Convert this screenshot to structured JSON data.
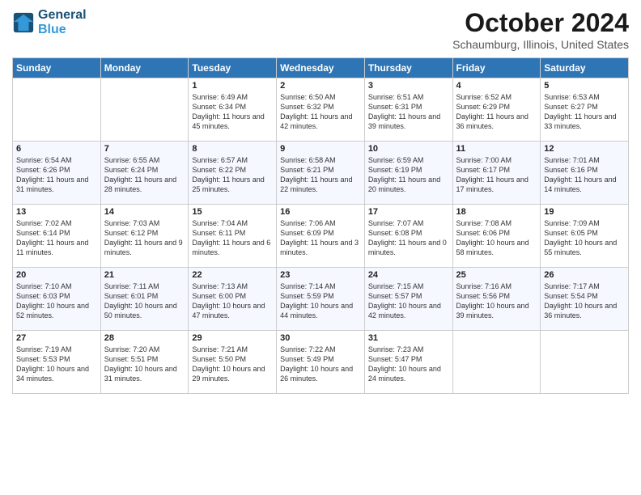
{
  "header": {
    "logo_line1": "General",
    "logo_line2": "Blue",
    "month": "October 2024",
    "location": "Schaumburg, Illinois, United States"
  },
  "weekdays": [
    "Sunday",
    "Monday",
    "Tuesday",
    "Wednesday",
    "Thursday",
    "Friday",
    "Saturday"
  ],
  "weeks": [
    [
      {
        "day": "",
        "info": ""
      },
      {
        "day": "",
        "info": ""
      },
      {
        "day": "1",
        "info": "Sunrise: 6:49 AM\nSunset: 6:34 PM\nDaylight: 11 hours and 45 minutes."
      },
      {
        "day": "2",
        "info": "Sunrise: 6:50 AM\nSunset: 6:32 PM\nDaylight: 11 hours and 42 minutes."
      },
      {
        "day": "3",
        "info": "Sunrise: 6:51 AM\nSunset: 6:31 PM\nDaylight: 11 hours and 39 minutes."
      },
      {
        "day": "4",
        "info": "Sunrise: 6:52 AM\nSunset: 6:29 PM\nDaylight: 11 hours and 36 minutes."
      },
      {
        "day": "5",
        "info": "Sunrise: 6:53 AM\nSunset: 6:27 PM\nDaylight: 11 hours and 33 minutes."
      }
    ],
    [
      {
        "day": "6",
        "info": "Sunrise: 6:54 AM\nSunset: 6:26 PM\nDaylight: 11 hours and 31 minutes."
      },
      {
        "day": "7",
        "info": "Sunrise: 6:55 AM\nSunset: 6:24 PM\nDaylight: 11 hours and 28 minutes."
      },
      {
        "day": "8",
        "info": "Sunrise: 6:57 AM\nSunset: 6:22 PM\nDaylight: 11 hours and 25 minutes."
      },
      {
        "day": "9",
        "info": "Sunrise: 6:58 AM\nSunset: 6:21 PM\nDaylight: 11 hours and 22 minutes."
      },
      {
        "day": "10",
        "info": "Sunrise: 6:59 AM\nSunset: 6:19 PM\nDaylight: 11 hours and 20 minutes."
      },
      {
        "day": "11",
        "info": "Sunrise: 7:00 AM\nSunset: 6:17 PM\nDaylight: 11 hours and 17 minutes."
      },
      {
        "day": "12",
        "info": "Sunrise: 7:01 AM\nSunset: 6:16 PM\nDaylight: 11 hours and 14 minutes."
      }
    ],
    [
      {
        "day": "13",
        "info": "Sunrise: 7:02 AM\nSunset: 6:14 PM\nDaylight: 11 hours and 11 minutes."
      },
      {
        "day": "14",
        "info": "Sunrise: 7:03 AM\nSunset: 6:12 PM\nDaylight: 11 hours and 9 minutes."
      },
      {
        "day": "15",
        "info": "Sunrise: 7:04 AM\nSunset: 6:11 PM\nDaylight: 11 hours and 6 minutes."
      },
      {
        "day": "16",
        "info": "Sunrise: 7:06 AM\nSunset: 6:09 PM\nDaylight: 11 hours and 3 minutes."
      },
      {
        "day": "17",
        "info": "Sunrise: 7:07 AM\nSunset: 6:08 PM\nDaylight: 11 hours and 0 minutes."
      },
      {
        "day": "18",
        "info": "Sunrise: 7:08 AM\nSunset: 6:06 PM\nDaylight: 10 hours and 58 minutes."
      },
      {
        "day": "19",
        "info": "Sunrise: 7:09 AM\nSunset: 6:05 PM\nDaylight: 10 hours and 55 minutes."
      }
    ],
    [
      {
        "day": "20",
        "info": "Sunrise: 7:10 AM\nSunset: 6:03 PM\nDaylight: 10 hours and 52 minutes."
      },
      {
        "day": "21",
        "info": "Sunrise: 7:11 AM\nSunset: 6:01 PM\nDaylight: 10 hours and 50 minutes."
      },
      {
        "day": "22",
        "info": "Sunrise: 7:13 AM\nSunset: 6:00 PM\nDaylight: 10 hours and 47 minutes."
      },
      {
        "day": "23",
        "info": "Sunrise: 7:14 AM\nSunset: 5:59 PM\nDaylight: 10 hours and 44 minutes."
      },
      {
        "day": "24",
        "info": "Sunrise: 7:15 AM\nSunset: 5:57 PM\nDaylight: 10 hours and 42 minutes."
      },
      {
        "day": "25",
        "info": "Sunrise: 7:16 AM\nSunset: 5:56 PM\nDaylight: 10 hours and 39 minutes."
      },
      {
        "day": "26",
        "info": "Sunrise: 7:17 AM\nSunset: 5:54 PM\nDaylight: 10 hours and 36 minutes."
      }
    ],
    [
      {
        "day": "27",
        "info": "Sunrise: 7:19 AM\nSunset: 5:53 PM\nDaylight: 10 hours and 34 minutes."
      },
      {
        "day": "28",
        "info": "Sunrise: 7:20 AM\nSunset: 5:51 PM\nDaylight: 10 hours and 31 minutes."
      },
      {
        "day": "29",
        "info": "Sunrise: 7:21 AM\nSunset: 5:50 PM\nDaylight: 10 hours and 29 minutes."
      },
      {
        "day": "30",
        "info": "Sunrise: 7:22 AM\nSunset: 5:49 PM\nDaylight: 10 hours and 26 minutes."
      },
      {
        "day": "31",
        "info": "Sunrise: 7:23 AM\nSunset: 5:47 PM\nDaylight: 10 hours and 24 minutes."
      },
      {
        "day": "",
        "info": ""
      },
      {
        "day": "",
        "info": ""
      }
    ]
  ]
}
